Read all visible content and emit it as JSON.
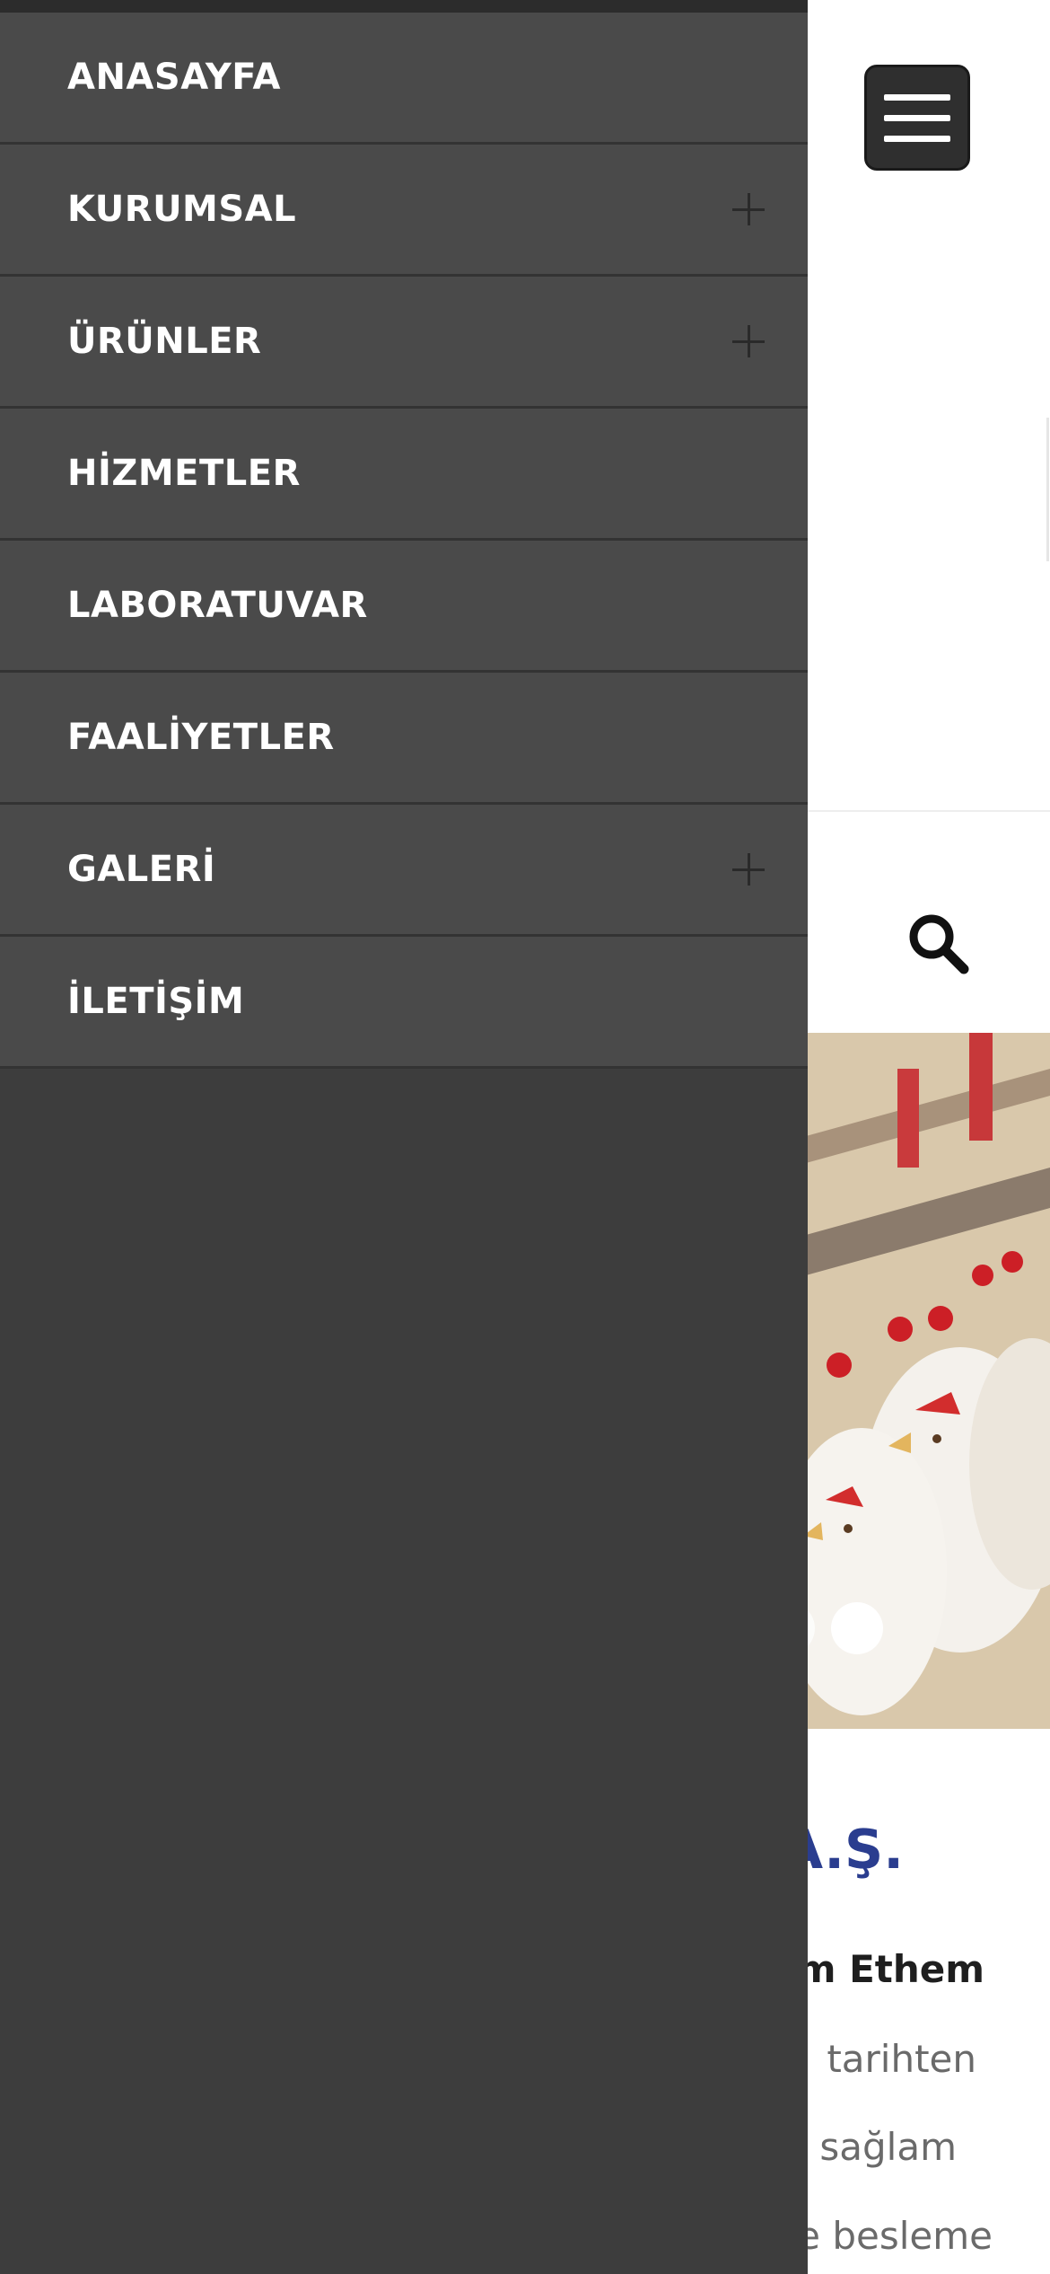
{
  "nav": {
    "items": [
      {
        "label": "ANASAYFA",
        "expandable": false
      },
      {
        "label": "KURUMSAL",
        "expandable": true
      },
      {
        "label": "ÜRÜNLER",
        "expandable": true
      },
      {
        "label": "HİZMETLER",
        "expandable": false
      },
      {
        "label": "LABORATUVAR",
        "expandable": false
      },
      {
        "label": "FAALİYETLER",
        "expandable": false
      },
      {
        "label": "GALERİ",
        "expandable": true
      },
      {
        "label": "İLETİŞİM",
        "expandable": false
      }
    ]
  },
  "header": {
    "menu_icon": "hamburger-icon",
    "search_icon": "search-icon"
  },
  "hero": {
    "slide_count_visible": 2,
    "active_slide": 2
  },
  "content": {
    "company_title_fragment": "A.Ş.",
    "intro_bold_fragment": "m Ethem",
    "intro_lines": [
      "tarihten",
      "sağlam",
      "e besleme"
    ]
  },
  "colors": {
    "drawer_bg": "#3d3d3d",
    "nav_item_bg": "#4a4a4a",
    "accent_title": "#2a3d8f"
  }
}
